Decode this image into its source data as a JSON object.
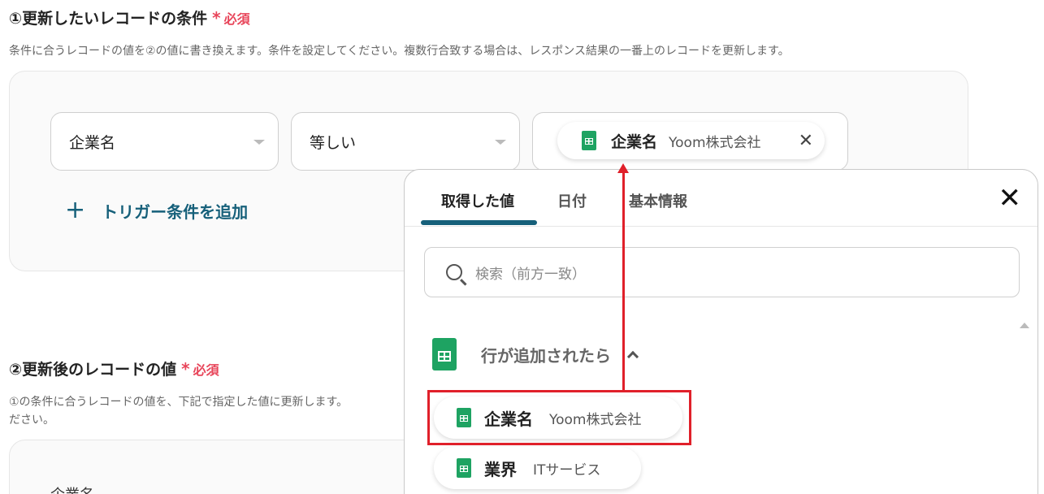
{
  "section1": {
    "title": "①更新したいレコードの条件",
    "required_star": "*",
    "required_label": "必須",
    "description": "条件に合うレコードの値を②の値に書き換えます。条件を設定してください。複数行合致する場合は、レスポンス結果の一番上のレコードを更新します。",
    "field_select": "企業名",
    "operator_select": "等しい",
    "value_chip": {
      "label": "企業名",
      "value": "Yoom株式会社",
      "icon": "spreadsheet-icon"
    },
    "add_trigger_label": "トリガー条件を追加"
  },
  "section2": {
    "title": "②更新後のレコードの値",
    "required_star": "*",
    "required_label": "必須",
    "description_line1": "①の条件に合うレコードの値を、下記で指定した値に更新します。",
    "description_line2": "ださい。",
    "field_label": "企業名"
  },
  "panel": {
    "tabs": [
      {
        "label": "取得した値",
        "active": true
      },
      {
        "label": "日付",
        "active": false
      },
      {
        "label": "基本情報",
        "active": false
      }
    ],
    "search_placeholder": "検索（前方一致）",
    "group_title": "行が追加されたら",
    "items": [
      {
        "label": "企業名",
        "value": "Yoom株式会社"
      },
      {
        "label": "業界",
        "value": "ITサービス"
      }
    ]
  },
  "colors": {
    "accent": "#16607a",
    "required": "#e8455a",
    "sheet_green": "#1ea362",
    "annotation_red": "#e0202a"
  }
}
